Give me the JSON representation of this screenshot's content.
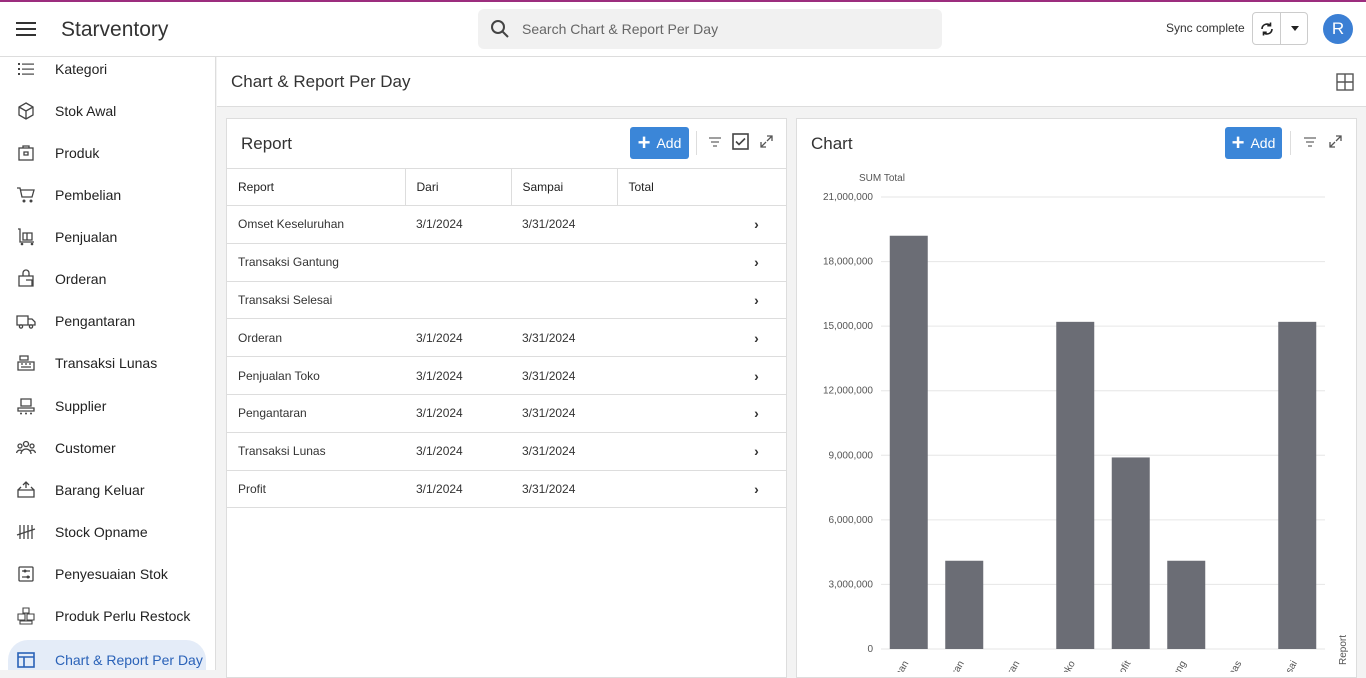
{
  "header": {
    "app_title": "Starventory",
    "search_placeholder": "Search Chart & Report Per Day",
    "sync_status": "Sync complete",
    "avatar_initial": "R"
  },
  "sidebar": {
    "items": [
      {
        "label": "Kategori",
        "icon": "list-icon"
      },
      {
        "label": "Stok Awal",
        "icon": "box-icon"
      },
      {
        "label": "Produk",
        "icon": "package-icon"
      },
      {
        "label": "Pembelian",
        "icon": "cart-icon"
      },
      {
        "label": "Penjualan",
        "icon": "trolley-icon"
      },
      {
        "label": "Orderan",
        "icon": "shopping-bag-icon"
      },
      {
        "label": "Pengantaran",
        "icon": "truck-icon"
      },
      {
        "label": "Transaksi Lunas",
        "icon": "cash-register-icon"
      },
      {
        "label": "Supplier",
        "icon": "conveyor-icon"
      },
      {
        "label": "Customer",
        "icon": "people-icon"
      },
      {
        "label": "Barang Keluar",
        "icon": "box-out-icon"
      },
      {
        "label": "Stock Opname",
        "icon": "tally-icon"
      },
      {
        "label": "Penyesuaian Stok",
        "icon": "adjust-icon"
      },
      {
        "label": "Produk Perlu Restock",
        "icon": "boxes-icon"
      },
      {
        "label": "Chart & Report Per Day",
        "icon": "layout-icon",
        "active": true
      }
    ]
  },
  "page": {
    "title": "Chart & Report Per Day"
  },
  "report_panel": {
    "title": "Report",
    "add_label": "Add",
    "columns": [
      "Report",
      "Dari",
      "Sampai",
      "Total"
    ],
    "rows": [
      {
        "report": "Omset Keseluruhan",
        "dari": "3/1/2024",
        "sampai": "3/31/2024",
        "total": ""
      },
      {
        "report": "Transaksi Gantung",
        "dari": "",
        "sampai": "",
        "total": ""
      },
      {
        "report": "Transaksi Selesai",
        "dari": "",
        "sampai": "",
        "total": ""
      },
      {
        "report": "Orderan",
        "dari": "3/1/2024",
        "sampai": "3/31/2024",
        "total": ""
      },
      {
        "report": "Penjualan Toko",
        "dari": "3/1/2024",
        "sampai": "3/31/2024",
        "total": ""
      },
      {
        "report": "Pengantaran",
        "dari": "3/1/2024",
        "sampai": "3/31/2024",
        "total": ""
      },
      {
        "report": "Transaksi Lunas",
        "dari": "3/1/2024",
        "sampai": "3/31/2024",
        "total": ""
      },
      {
        "report": "Profit",
        "dari": "3/1/2024",
        "sampai": "3/31/2024",
        "total": ""
      }
    ]
  },
  "chart_panel": {
    "title": "Chart",
    "add_label": "Add"
  },
  "chart_data": {
    "type": "bar",
    "ylabel": "SUM Total",
    "xlabel": "Report",
    "ylim": [
      0,
      21000000
    ],
    "yticks": [
      "0",
      "3,000,000",
      "6,000,000",
      "9,000,000",
      "12,000,000",
      "15,000,000",
      "18,000,000",
      "21,000,000"
    ],
    "categories": [
      "...uhan",
      "...leran",
      "...taran",
      "...Toko",
      "...rofit",
      "...tung",
      "...lunas",
      "...lesai"
    ],
    "values": [
      19200000,
      4100000,
      0,
      15200000,
      8900000,
      4100000,
      0,
      15200000
    ],
    "bar_color": "#6b6d75",
    "grid": true
  }
}
